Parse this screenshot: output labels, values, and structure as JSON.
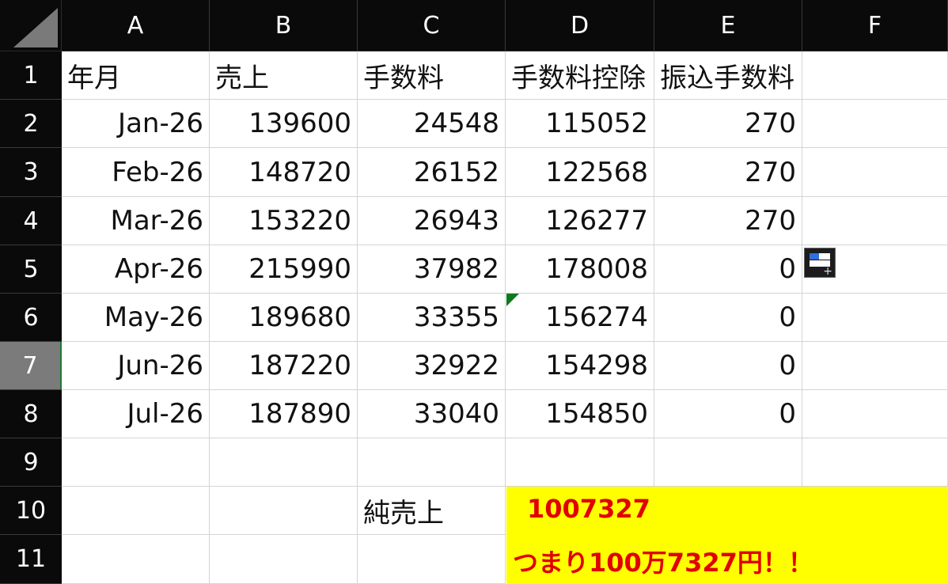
{
  "columns": [
    "A",
    "B",
    "C",
    "D",
    "E",
    "F"
  ],
  "rows": [
    "1",
    "2",
    "3",
    "4",
    "5",
    "6",
    "7",
    "8",
    "9",
    "10",
    "11"
  ],
  "header": [
    "年月",
    "売上",
    "手数料",
    "手数料控除",
    "振込手数料"
  ],
  "data": [
    [
      "Jan-26",
      "139600",
      "24548",
      "115052",
      "270"
    ],
    [
      "Feb-26",
      "148720",
      "26152",
      "122568",
      "270"
    ],
    [
      "Mar-26",
      "153220",
      "26943",
      "126277",
      "270"
    ],
    [
      "Apr-26",
      "215990",
      "37982",
      "178008",
      "0"
    ],
    [
      "May-26",
      "189680",
      "33355",
      "156274",
      "0"
    ],
    [
      "Jun-26",
      "187220",
      "32922",
      "154298",
      "0"
    ],
    [
      "Jul-26",
      "187890",
      "33040",
      "154850",
      "0"
    ]
  ],
  "net_sales_label": "純売上",
  "net_sales_value": "1007327",
  "net_sales_note": "つまり100万7327円！！",
  "colors": {
    "highlight": "#ffff00",
    "result_text": "#e00000",
    "selected_row_header": "#7b7b7b"
  },
  "icons": {
    "corner": "select-all-icon",
    "quick_analysis": "quick-analysis-icon",
    "error_indicator": "cell-error-indicator-icon"
  },
  "selected_row": "7"
}
